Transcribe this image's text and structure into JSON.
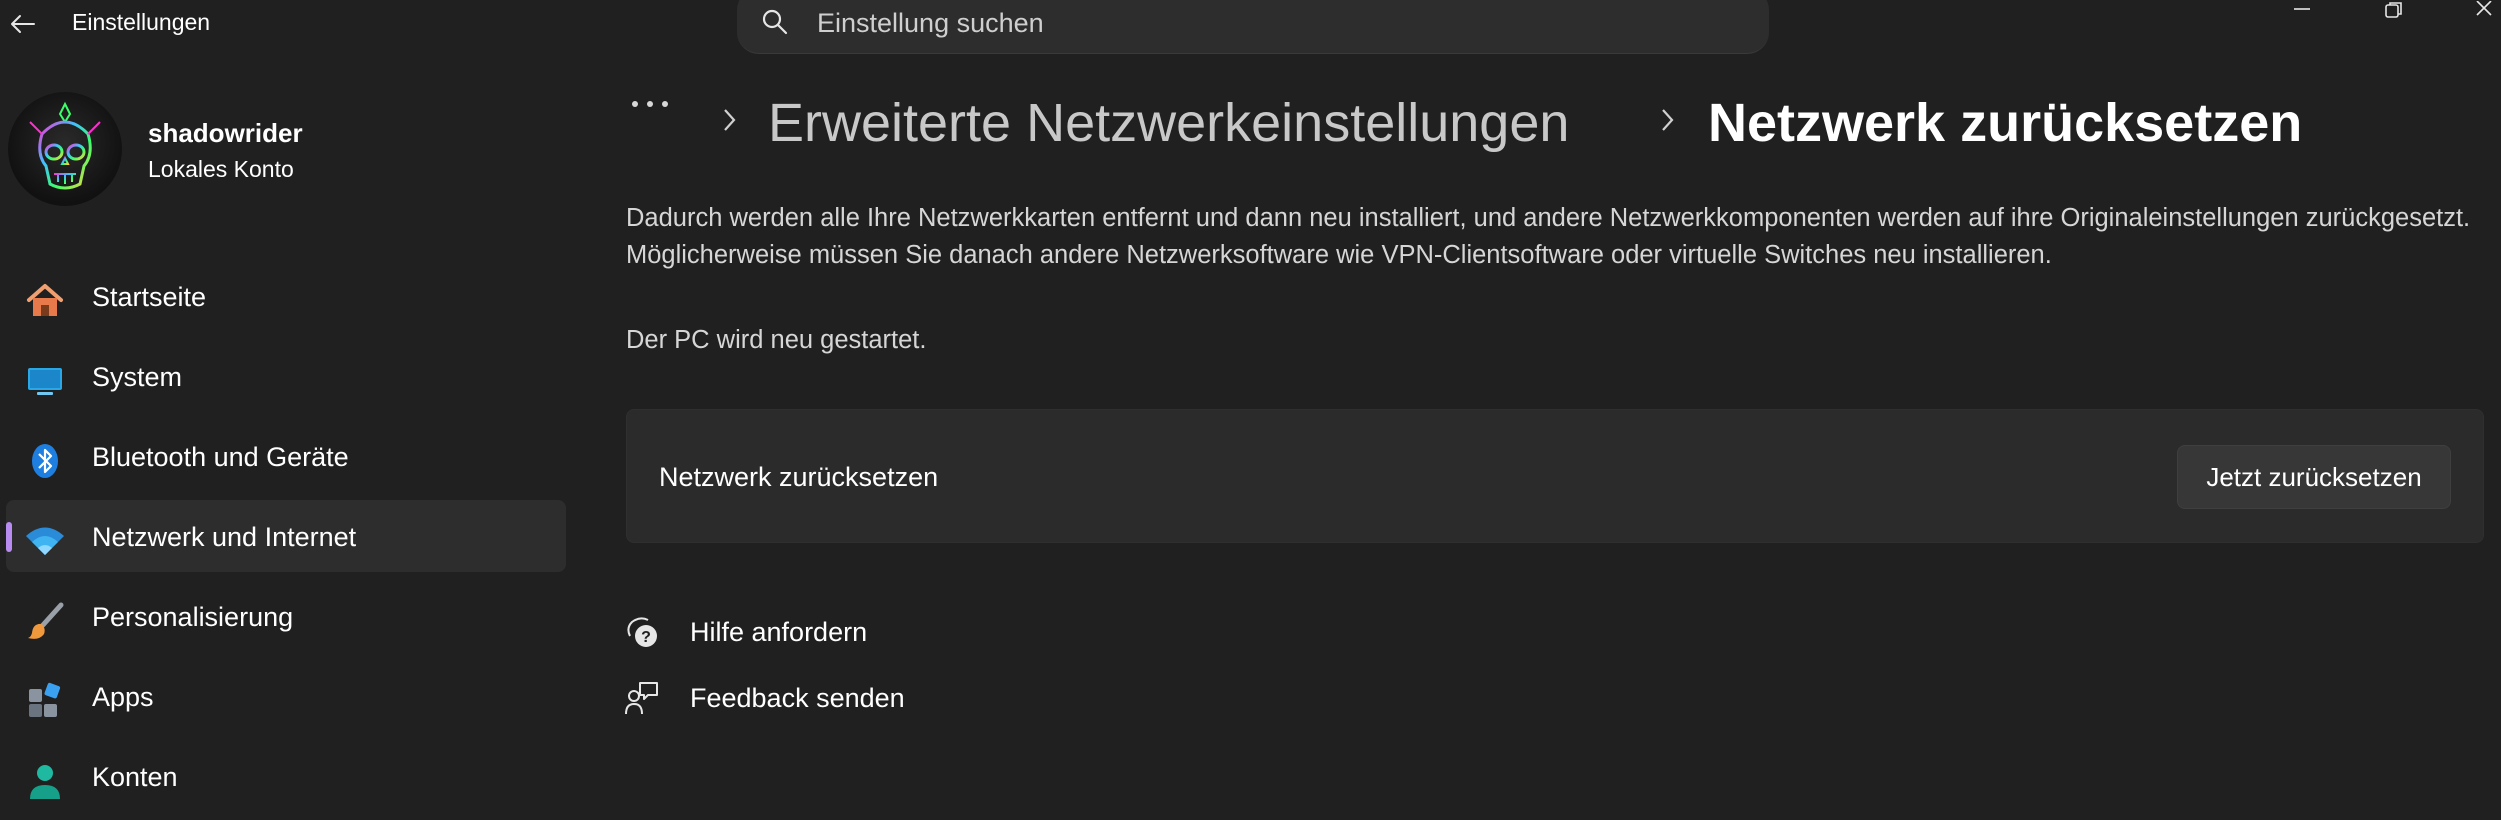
{
  "window": {
    "title": "Einstellungen"
  },
  "search": {
    "placeholder": "Einstellung suchen"
  },
  "profile": {
    "name": "shadowrider",
    "account_type": "Lokales Konto"
  },
  "sidebar": {
    "items": [
      {
        "label": "Startseite",
        "icon": "home-icon"
      },
      {
        "label": "System",
        "icon": "monitor-icon"
      },
      {
        "label": "Bluetooth und Geräte",
        "icon": "bluetooth-icon"
      },
      {
        "label": "Netzwerk und Internet",
        "icon": "wifi-icon",
        "active": true
      },
      {
        "label": "Personalisierung",
        "icon": "brush-icon"
      },
      {
        "label": "Apps",
        "icon": "apps-icon"
      },
      {
        "label": "Konten",
        "icon": "person-icon"
      }
    ],
    "accent_color": "#b98cf2"
  },
  "breadcrumb": {
    "parent": "Erweiterte Netzwerkeinstellungen",
    "current": "Netzwerk zurücksetzen"
  },
  "main": {
    "description": "Dadurch werden alle Ihre Netzwerkkarten entfernt und dann neu installiert, und andere Netzwerkkomponenten werden auf ihre Originaleinstellungen zurückgesetzt. Möglicherweise müssen Sie danach andere Netzwerksoftware wie VPN-Clientsoftware oder virtuelle Switches neu installieren.",
    "restart_note": "Der PC wird neu gestartet.",
    "card": {
      "label": "Netzwerk zurücksetzen",
      "button": "Jetzt zurücksetzen"
    },
    "links": {
      "help": "Hilfe anfordern",
      "feedback": "Feedback senden"
    }
  }
}
